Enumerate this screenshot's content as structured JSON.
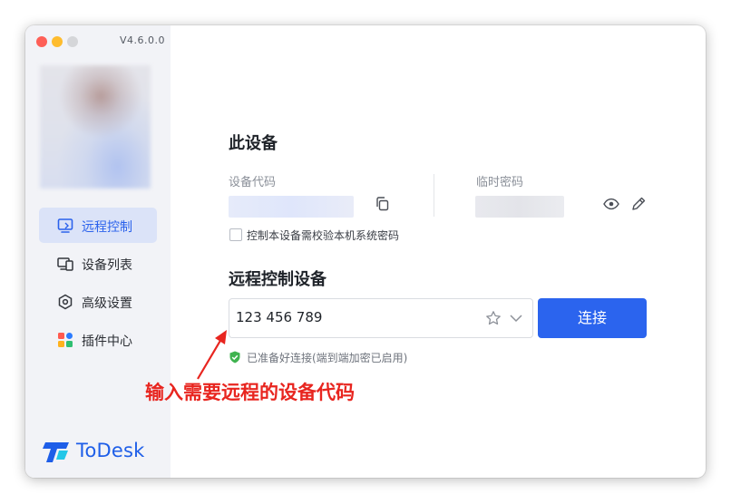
{
  "app": {
    "version": "V4.6.0.0",
    "logo_text": "ToDesk",
    "brand_color": "#1e5ee8"
  },
  "sidebar": {
    "items": [
      {
        "label": "远程控制",
        "icon": "monitor-remote-icon",
        "active": true
      },
      {
        "label": "设备列表",
        "icon": "devices-icon",
        "active": false
      },
      {
        "label": "高级设置",
        "icon": "settings-hexagon-icon",
        "active": false
      },
      {
        "label": "插件中心",
        "icon": "plugin-grid-icon",
        "active": false
      }
    ]
  },
  "this_device": {
    "title": "此设备",
    "device_code_label": "设备代码",
    "temp_password_label": "临时密码",
    "verify_checkbox_label": "控制本设备需校验本机系统密码",
    "verify_checked": false
  },
  "remote": {
    "title": "远程控制设备",
    "input_value": "123 456 789",
    "connect_label": "连接",
    "status_text": "已准备好连接(端到端加密已启用)",
    "status_color": "#3fb34f",
    "accent_color": "#2b64ee"
  },
  "annotation": {
    "text": "输入需要远程的设备代码",
    "color": "#e8251f"
  }
}
